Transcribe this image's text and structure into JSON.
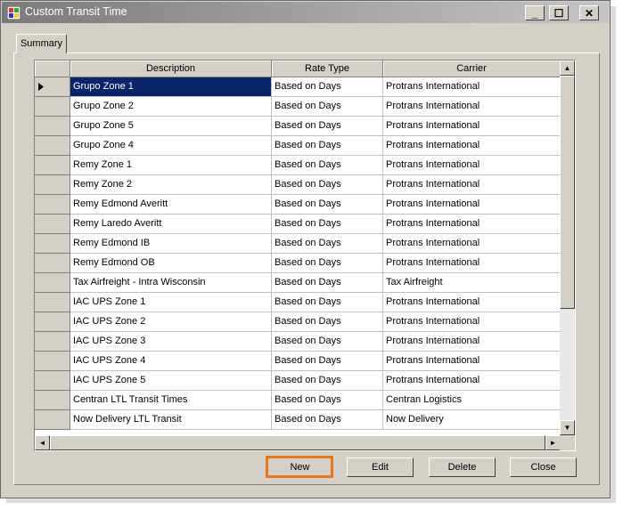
{
  "window": {
    "title": "Custom Transit Time"
  },
  "titlebar_buttons": {
    "minimize": "_",
    "maximize": "☐",
    "close": "✕"
  },
  "tabs": [
    {
      "label": "Summary"
    }
  ],
  "grid": {
    "columns": [
      "Description",
      "Rate Type",
      "Carrier"
    ],
    "selected_row": 0,
    "rows": [
      {
        "description": "Grupo Zone 1",
        "rate_type": "Based on Days",
        "carrier": "Protrans International"
      },
      {
        "description": "Grupo Zone 2",
        "rate_type": "Based on Days",
        "carrier": "Protrans International"
      },
      {
        "description": "Grupo Zone 5",
        "rate_type": "Based on Days",
        "carrier": "Protrans International"
      },
      {
        "description": "Grupo Zone 4",
        "rate_type": "Based on Days",
        "carrier": "Protrans International"
      },
      {
        "description": "Remy Zone 1",
        "rate_type": "Based on Days",
        "carrier": "Protrans International"
      },
      {
        "description": "Remy Zone 2",
        "rate_type": "Based on Days",
        "carrier": "Protrans International"
      },
      {
        "description": "Remy Edmond Averitt",
        "rate_type": "Based on Days",
        "carrier": "Protrans International"
      },
      {
        "description": "Remy Laredo Averitt",
        "rate_type": "Based on Days",
        "carrier": "Protrans International"
      },
      {
        "description": "Remy Edmond IB",
        "rate_type": "Based on Days",
        "carrier": "Protrans International"
      },
      {
        "description": "Remy Edmond OB",
        "rate_type": "Based on Days",
        "carrier": "Protrans International"
      },
      {
        "description": "Tax Airfreight - Intra Wisconsin",
        "rate_type": "Based on Days",
        "carrier": "Tax Airfreight"
      },
      {
        "description": "IAC UPS Zone 1",
        "rate_type": "Based on Days",
        "carrier": "Protrans International"
      },
      {
        "description": "IAC UPS Zone 2",
        "rate_type": "Based on Days",
        "carrier": "Protrans International"
      },
      {
        "description": "IAC UPS Zone 3",
        "rate_type": "Based on Days",
        "carrier": "Protrans International"
      },
      {
        "description": "IAC UPS Zone 4",
        "rate_type": "Based on Days",
        "carrier": "Protrans International"
      },
      {
        "description": "IAC UPS Zone 5",
        "rate_type": "Based on Days",
        "carrier": "Protrans International"
      },
      {
        "description": "Centran LTL Transit Times",
        "rate_type": "Based on Days",
        "carrier": "Centran Logistics"
      },
      {
        "description": "Now Delivery LTL Transit",
        "rate_type": "Based on Days",
        "carrier": "Now Delivery"
      }
    ]
  },
  "scroll_icons": {
    "up": "▲",
    "down": "▼",
    "left": "◄",
    "right": "►"
  },
  "buttons": {
    "new": "New",
    "edit": "Edit",
    "delete": "Delete",
    "close": "Close"
  },
  "colors": {
    "selection": "#0a246a",
    "highlight": "#e87722",
    "face": "#d4d0c8"
  }
}
